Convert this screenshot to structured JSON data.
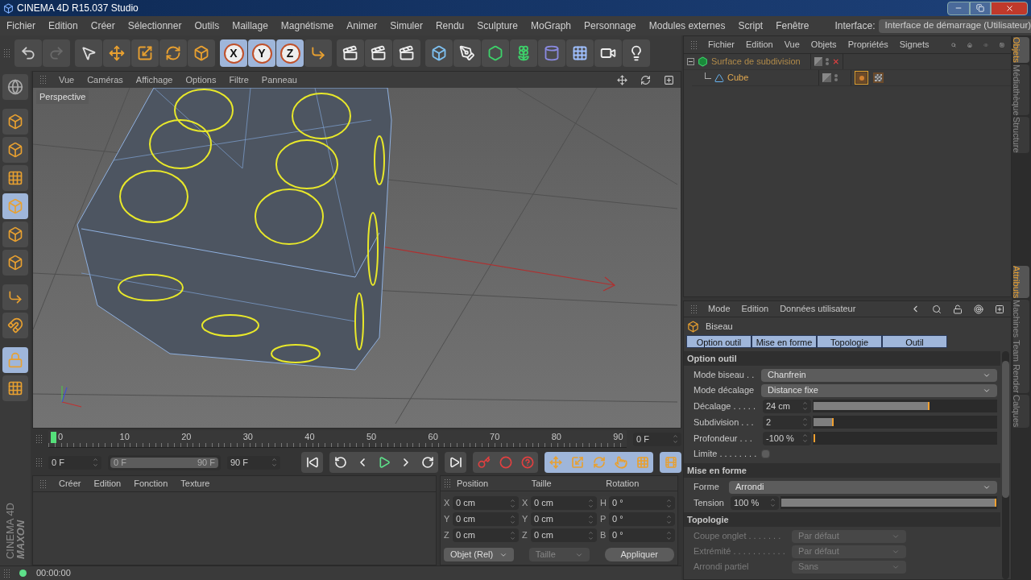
{
  "window": {
    "title": "CINEMA 4D R15.037 Studio"
  },
  "menu_bar": {
    "items": [
      "Fichier",
      "Edition",
      "Créer",
      "Sélectionner",
      "Outils",
      "Maillage",
      "Magnétisme",
      "Animer",
      "Simuler",
      "Rendu",
      "Sculpture",
      "MoGraph",
      "Personnage",
      "Modules externes",
      "Script",
      "Fenêtre"
    ],
    "interface_label": "Interface:",
    "interface_value": "Interface de démarrage (Utilisateur)"
  },
  "toolbar": {
    "redo": {
      "disabled": true
    },
    "axis_buttons": [
      {
        "label": "X",
        "on": true
      },
      {
        "label": "Y",
        "on": true
      },
      {
        "label": "Z",
        "on": true
      }
    ]
  },
  "left_palette": {
    "tools": [
      {
        "selected": false
      },
      {
        "selected": false
      },
      {
        "selected": false
      },
      {
        "selected": false
      },
      {
        "selected": true
      },
      {
        "selected": false
      },
      {
        "selected": false
      },
      {
        "selected": false
      },
      {
        "selected": false
      },
      {
        "selected": true
      },
      {
        "selected": false
      }
    ]
  },
  "viewport": {
    "menu": [
      "Vue",
      "Caméras",
      "Affichage",
      "Options",
      "Filtre",
      "Panneau"
    ],
    "camera_label": "Perspective"
  },
  "timeline": {
    "ticks": [
      "0",
      "10",
      "20",
      "30",
      "40",
      "50",
      "60",
      "70",
      "80",
      "90"
    ],
    "playhead": {
      "level": 0
    },
    "current_frame": "0 F"
  },
  "transport": {
    "start": "0 F",
    "range": {
      "start": "0 F",
      "end": "90 F",
      "level": 1
    },
    "end": "90 F"
  },
  "material_manager": {
    "menu": [
      "Créer",
      "Edition",
      "Fonction",
      "Texture"
    ]
  },
  "coordinates": {
    "headers": [
      "Position",
      "Taille",
      "Rotation"
    ],
    "rows": [
      {
        "fields": [
          {
            "axis": "X",
            "value": "0 cm"
          },
          {
            "axis": "X",
            "value": "0 cm"
          },
          {
            "axis": "H",
            "value": "0 °"
          }
        ]
      },
      {
        "fields": [
          {
            "axis": "Y",
            "value": "0 cm"
          },
          {
            "axis": "Y",
            "value": "0 cm"
          },
          {
            "axis": "P",
            "value": "0 °"
          }
        ]
      },
      {
        "fields": [
          {
            "axis": "Z",
            "value": "0 cm"
          },
          {
            "axis": "Z",
            "value": "0 cm"
          },
          {
            "axis": "B",
            "value": "0 °"
          }
        ]
      }
    ],
    "mode": "Objet (Rel)",
    "size_mode": {
      "label": "Taille",
      "disabled": true
    },
    "apply": "Appliquer"
  },
  "logo": {
    "brand": "MAXON",
    "product": "CINEMA 4D"
  },
  "status_bar": {
    "time": "00:00:00"
  },
  "object_manager": {
    "menu": [
      "Fichier",
      "Edition",
      "Vue",
      "Objets",
      "Propriétés",
      "Signets"
    ],
    "objects": [
      {
        "name": "Surface de subdivision",
        "enabled": false,
        "expanded": true,
        "children": [
          {
            "name": "Cube",
            "tags": [
              {
                "kind": "phong",
                "selected": true
              },
              {
                "kind": "texture",
                "selected": false
              }
            ]
          }
        ]
      }
    ]
  },
  "side_tabs_top": [
    {
      "label": "Objets",
      "selected": true
    },
    {
      "label": "Médiathèque",
      "selected": false
    },
    {
      "label": "Structure",
      "selected": false
    }
  ],
  "attributes": {
    "menu": [
      "Mode",
      "Edition",
      "Données utilisateur"
    ],
    "title": "Biseau",
    "tabs": [
      {
        "label": "Option outil",
        "selected": true
      },
      {
        "label": "Mise en forme",
        "selected": true
      },
      {
        "label": "Topologie",
        "selected": true
      },
      {
        "label": "Outil",
        "selected": true
      }
    ],
    "sections": [
      {
        "title": "Option outil",
        "rows": [
          {
            "kind": "dropdown",
            "label": "Mode biseau . .",
            "value": "Chanfrein",
            "disabled": false
          },
          {
            "kind": "dropdown",
            "label": "Mode décalage",
            "value": "Distance fixe",
            "disabled": false
          },
          {
            "kind": "slider",
            "label": "Décalage . . . . .",
            "value": "24 cm",
            "level": 0.63
          },
          {
            "kind": "slider",
            "label": "Subdivision . . .",
            "value": "2",
            "level": 0.1
          },
          {
            "kind": "slider",
            "label": "Profondeur . . .",
            "value": "-100 %",
            "level": 0
          },
          {
            "kind": "checkbox",
            "label": "Limite . . . . . . . .",
            "checked": false
          }
        ]
      },
      {
        "title": "Mise en forme",
        "rows": [
          {
            "kind": "dropdown",
            "label": "Forme",
            "value": "Arrondi",
            "disabled": false
          },
          {
            "kind": "slider",
            "label": "Tension",
            "value": "100 %",
            "level": 1
          }
        ]
      },
      {
        "title": "Topologie",
        "rows": [
          {
            "kind": "dropdown",
            "label": "Coupe onglet . . . . . . .",
            "value": "Par défaut",
            "disabled": true
          },
          {
            "kind": "dropdown",
            "label": "Extrémité . . . . . . . . . . .",
            "value": "Par défaut",
            "disabled": true
          },
          {
            "kind": "dropdown",
            "label": "Arrondi partiel",
            "value": "Sans",
            "disabled": true
          }
        ]
      }
    ]
  },
  "side_tabs_bottom": [
    {
      "label": "Attributs",
      "selected": true
    },
    {
      "label": "Machines Team Render",
      "selected": false
    },
    {
      "label": "Calques",
      "selected": false
    }
  ]
}
